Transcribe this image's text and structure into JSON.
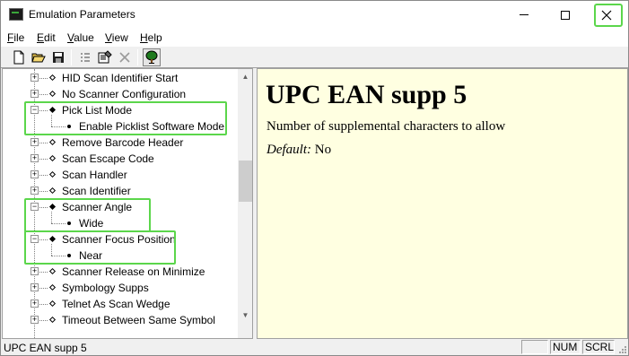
{
  "window": {
    "title": "Emulation Parameters"
  },
  "menu": [
    "File",
    "Edit",
    "Value",
    "View",
    "Help"
  ],
  "toolbar": {
    "buttons": [
      "new-icon",
      "open-icon",
      "save-icon",
      "list-icon",
      "properties-icon",
      "delete-icon",
      "tree-icon"
    ]
  },
  "tree": {
    "items": [
      {
        "label": "HID Scan Identifier Start",
        "level": 0,
        "expanded": false
      },
      {
        "label": "No Scanner Configuration",
        "level": 0,
        "expanded": false
      },
      {
        "label": "Pick List Mode",
        "level": 0,
        "expanded": true
      },
      {
        "label": "Enable Picklist Software Mode",
        "level": 1,
        "expanded": false
      },
      {
        "label": "Remove Barcode Header",
        "level": 0,
        "expanded": false
      },
      {
        "label": "Scan Escape Code",
        "level": 0,
        "expanded": false
      },
      {
        "label": "Scan Handler",
        "level": 0,
        "expanded": false
      },
      {
        "label": "Scan Identifier",
        "level": 0,
        "expanded": false
      },
      {
        "label": "Scanner Angle",
        "level": 0,
        "expanded": true
      },
      {
        "label": "Wide",
        "level": 1,
        "expanded": false
      },
      {
        "label": "Scanner Focus Position",
        "level": 0,
        "expanded": true
      },
      {
        "label": "Near",
        "level": 1,
        "expanded": false
      },
      {
        "label": "Scanner Release on Minimize",
        "level": 0,
        "expanded": false
      },
      {
        "label": "Symbology Supps",
        "level": 0,
        "expanded": false
      },
      {
        "label": "Telnet As Scan Wedge",
        "level": 0,
        "expanded": false
      },
      {
        "label": "Timeout Between Same Symbol",
        "level": 0,
        "expanded": false
      }
    ]
  },
  "description": {
    "title": "UPC EAN supp 5",
    "text": "Number of supplemental characters to allow",
    "default_label": "Default:",
    "default_value": "No"
  },
  "status": {
    "text": "UPC EAN supp 5",
    "panes": [
      "",
      "NUM",
      "SCRL"
    ]
  },
  "colors": {
    "highlight": "#5bd64b",
    "description_bg": "#ffffe1"
  }
}
